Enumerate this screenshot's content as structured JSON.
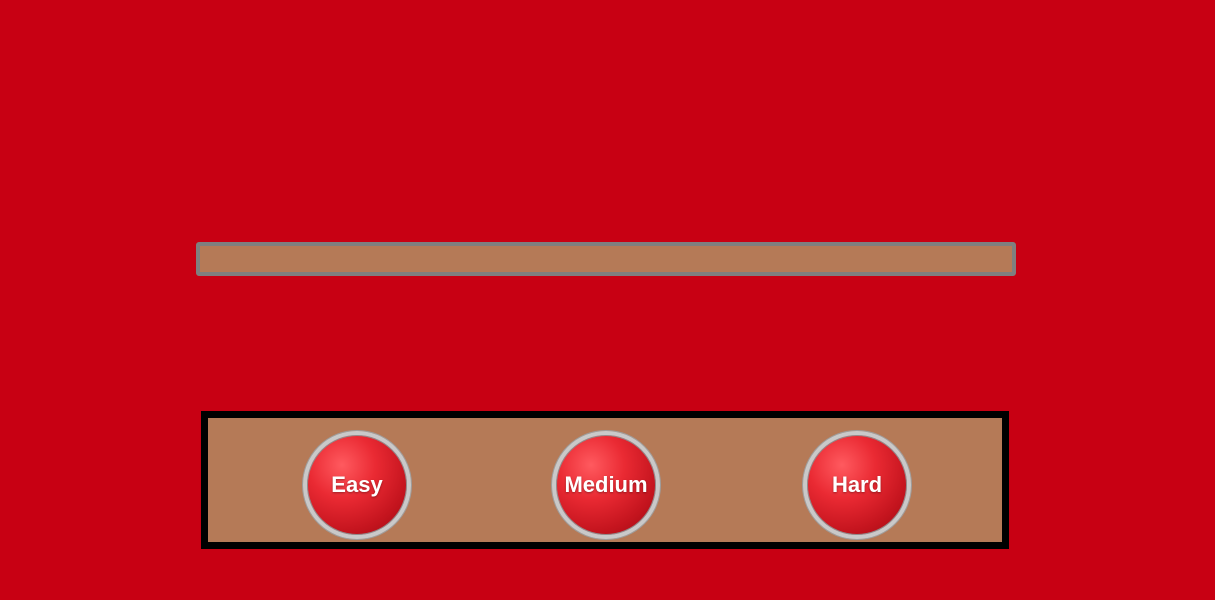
{
  "colors": {
    "background": "#c80013",
    "bar_fill": "#b57a57",
    "bar_border": "#7f7f7f",
    "panel_fill": "#b57a57",
    "panel_border": "#000000",
    "button_red": "#ea2a33"
  },
  "difficulty": {
    "buttons": [
      {
        "label": "Easy"
      },
      {
        "label": "Medium"
      },
      {
        "label": "Hard"
      }
    ]
  }
}
